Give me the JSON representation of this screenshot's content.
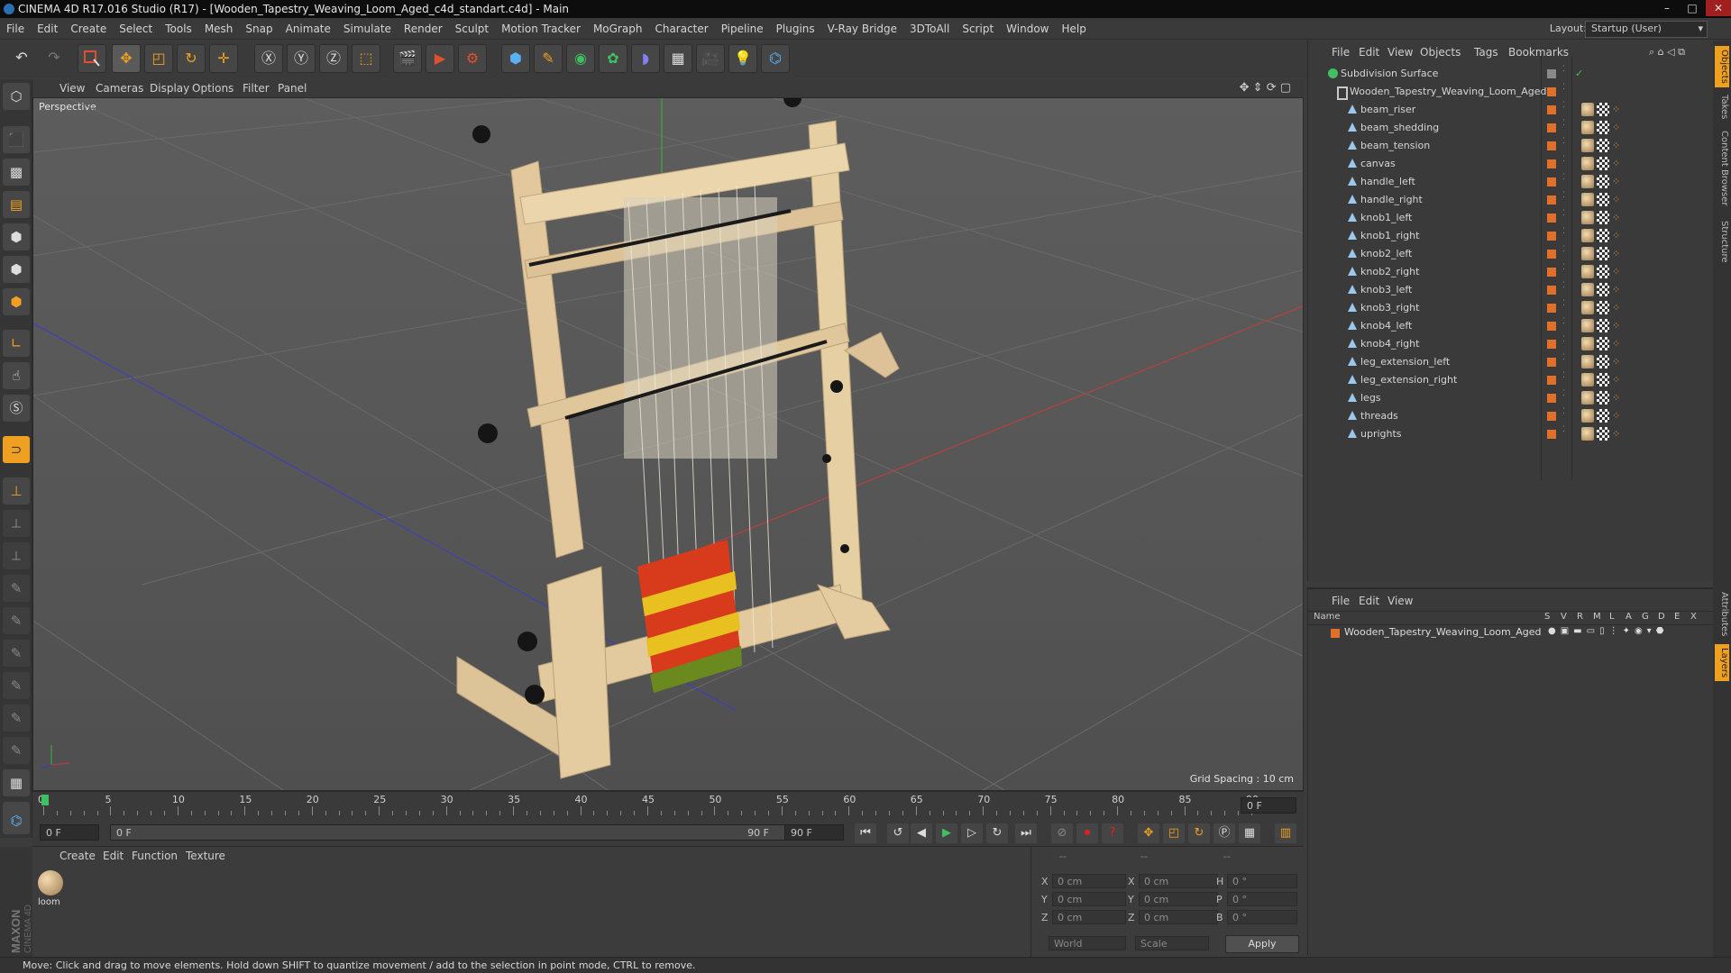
{
  "title_bar": {
    "title": "CINEMA 4D R17.016 Studio (R17) - [Wooden_Tapestry_Weaving_Loom_Aged_c4d_standart.c4d] - Main",
    "minimize": "–",
    "maximize": "□",
    "close": "✕"
  },
  "menu": [
    "File",
    "Edit",
    "Create",
    "Select",
    "Tools",
    "Mesh",
    "Snap",
    "Animate",
    "Simulate",
    "Render",
    "Sculpt",
    "Motion Tracker",
    "MoGraph",
    "Character",
    "Pipeline",
    "Plugins",
    "V-Ray Bridge",
    "3DToAll",
    "Script",
    "Window",
    "Help"
  ],
  "layout": {
    "label": "Layout:",
    "value": "Startup (User)"
  },
  "viewport": {
    "menu": [
      "View",
      "Cameras",
      "Display",
      "Options",
      "Filter",
      "Panel"
    ],
    "label": "Perspective",
    "grid_spacing": "Grid Spacing : 10 cm"
  },
  "timeline": {
    "ticks": [
      "0",
      "5",
      "10",
      "15",
      "20",
      "25",
      "30",
      "35",
      "40",
      "45",
      "50",
      "55",
      "60",
      "65",
      "70",
      "75",
      "80",
      "85",
      "90"
    ],
    "current_frame": "0 F",
    "start_field": "0 F",
    "range_start": "0 F",
    "range_end": "90 F",
    "end_field": "90 F"
  },
  "material_manager": {
    "menu": [
      "Create",
      "Edit",
      "Function",
      "Texture"
    ],
    "material_name": "loom"
  },
  "coordinates": {
    "header": [
      "--",
      "--",
      "--"
    ],
    "rows": [
      {
        "l1": "X",
        "v1": "0 cm",
        "l2": "X",
        "v2": "0 cm",
        "l3": "H",
        "v3": "0 °"
      },
      {
        "l1": "Y",
        "v1": "0 cm",
        "l2": "Y",
        "v2": "0 cm",
        "l3": "P",
        "v3": "0 °"
      },
      {
        "l1": "Z",
        "v1": "0 cm",
        "l2": "Z",
        "v2": "0 cm",
        "l3": "B",
        "v3": "0 °"
      }
    ],
    "mode": "World",
    "transform": "Scale",
    "apply": "Apply"
  },
  "status_bar": "Move: Click and drag to move elements. Hold down SHIFT to quantize movement / add to the selection in point mode, CTRL to remove.",
  "object_manager": {
    "menu": [
      "File",
      "Edit",
      "View",
      "Objects",
      "Tags",
      "Bookmarks"
    ],
    "root": "Subdivision Surface",
    "group": "Wooden_Tapestry_Weaving_Loom_Aged",
    "children": [
      "beam_riser",
      "beam_shedding",
      "beam_tension",
      "canvas",
      "handle_left",
      "handle_right",
      "knob1_left",
      "knob1_right",
      "knob2_left",
      "knob2_right",
      "knob3_left",
      "knob3_right",
      "knob4_left",
      "knob4_right",
      "leg_extension_left",
      "leg_extension_right",
      "legs",
      "threads",
      "uprights"
    ]
  },
  "layer_manager": {
    "menu": [
      "File",
      "Edit",
      "View"
    ],
    "name_header": "Name",
    "columns": [
      "S",
      "V",
      "R",
      "M",
      "L",
      "A",
      "G",
      "D",
      "E",
      "X"
    ],
    "layer": "Wooden_Tapestry_Weaving_Loom_Aged"
  },
  "side_tabs": [
    "Objects",
    "Takes",
    "Content Browser",
    "Structure"
  ],
  "side_tabs_lower": [
    "Attributes",
    "Layers"
  ],
  "colors": {
    "accent": "#f0a020",
    "layer_orange": "#e0702a",
    "axis_x": "#c83c3c",
    "axis_y": "#3cb43c",
    "axis_z": "#3c3cc8"
  }
}
